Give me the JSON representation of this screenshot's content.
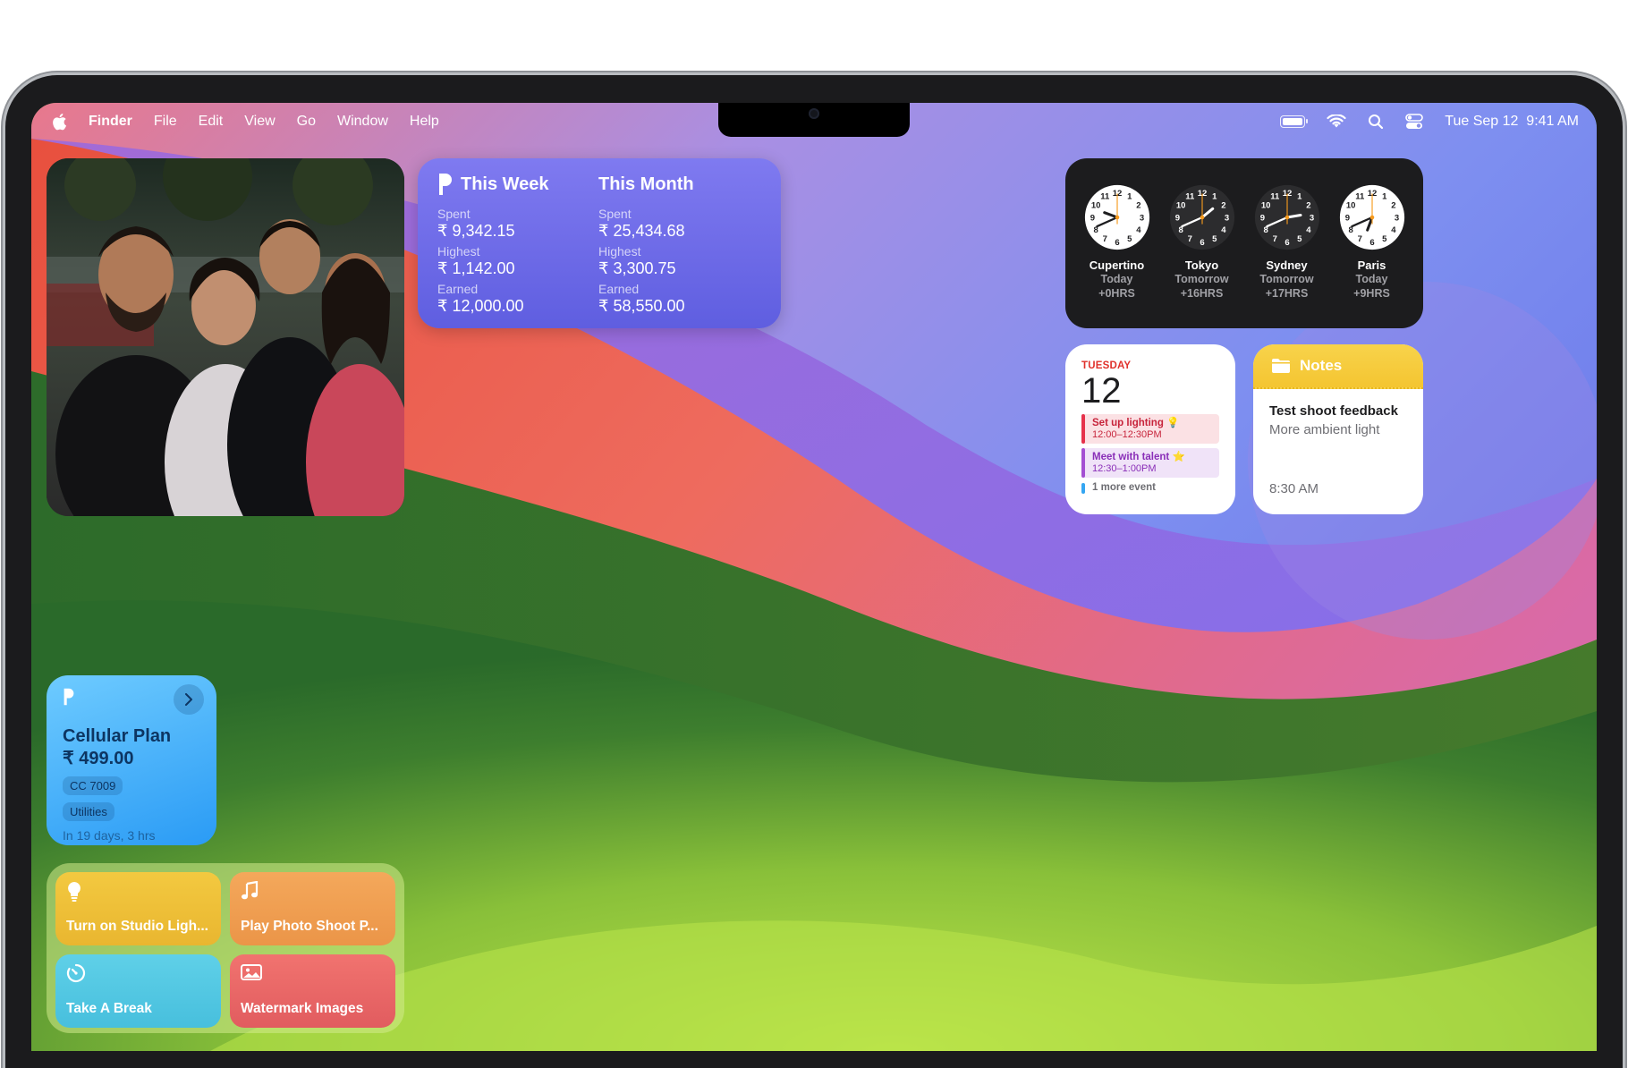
{
  "menubar": {
    "app": "Finder",
    "items": [
      "File",
      "Edit",
      "View",
      "Go",
      "Window",
      "Help"
    ],
    "datetime": "Tue Sep 12  9:41 AM",
    "battery_level": 0.9
  },
  "icons": [
    "apple-icon",
    "battery-icon",
    "wifi-icon",
    "search-icon",
    "control-center-icon",
    "chevron-right-icon",
    "lightbulb-icon",
    "music-note-icon",
    "timer-icon",
    "photo-icon",
    "folder-icon",
    "app-logo-icon"
  ],
  "finance": {
    "week": {
      "heading": "This Week",
      "spent_label": "Spent",
      "spent": "₹ 9,342.15",
      "highest_label": "Highest",
      "highest": "₹ 1,142.00",
      "earned_label": "Earned",
      "earned": "₹ 12,000.00"
    },
    "month": {
      "heading": "This Month",
      "spent_label": "Spent",
      "spent": "₹ 25,434.68",
      "highest_label": "Highest",
      "highest": "₹ 3,300.75",
      "earned_label": "Earned",
      "earned": "₹ 58,550.00"
    }
  },
  "clocks": [
    {
      "city": "Cupertino",
      "day": "Today",
      "offset": "+0HRS",
      "hour": 9,
      "minute": 41,
      "dark": false
    },
    {
      "city": "Tokyo",
      "day": "Tomorrow",
      "offset": "+16HRS",
      "hour": 1,
      "minute": 41,
      "dark": true
    },
    {
      "city": "Sydney",
      "day": "Tomorrow",
      "offset": "+17HRS",
      "hour": 2,
      "minute": 41,
      "dark": true
    },
    {
      "city": "Paris",
      "day": "Today",
      "offset": "+9HRS",
      "hour": 6,
      "minute": 41,
      "dark": false
    }
  ],
  "calendar": {
    "weekday": "TUESDAY",
    "date": "12",
    "events": [
      {
        "title": "Set up lighting 💡",
        "time": "12:00–12:30PM"
      },
      {
        "title": "Meet with talent ⭐",
        "time": "12:30–1:00PM"
      }
    ],
    "more": "1 more event"
  },
  "notes": {
    "header": "Notes",
    "title": "Test shoot feedback",
    "snippet": "More ambient light",
    "time": "8:30 AM"
  },
  "cellular": {
    "title": "Cellular Plan",
    "amount": "₹ 499.00",
    "tags": [
      "CC 7009",
      "Utilities"
    ],
    "due": "In 19 days, 3 hrs"
  },
  "shortcuts": [
    {
      "label": "Turn on Studio Ligh...",
      "icon": "lightbulb-icon"
    },
    {
      "label": "Play Photo Shoot P...",
      "icon": "music-note-icon"
    },
    {
      "label": "Take A Break",
      "icon": "timer-icon"
    },
    {
      "label": "Watermark Images",
      "icon": "photo-icon"
    }
  ],
  "colors": {
    "finance_accent": "#6f6ce8",
    "calendar_red": "#e0312b",
    "notes_yellow": "#f6ca3c",
    "cellular_blue": "#2a9bf5"
  }
}
